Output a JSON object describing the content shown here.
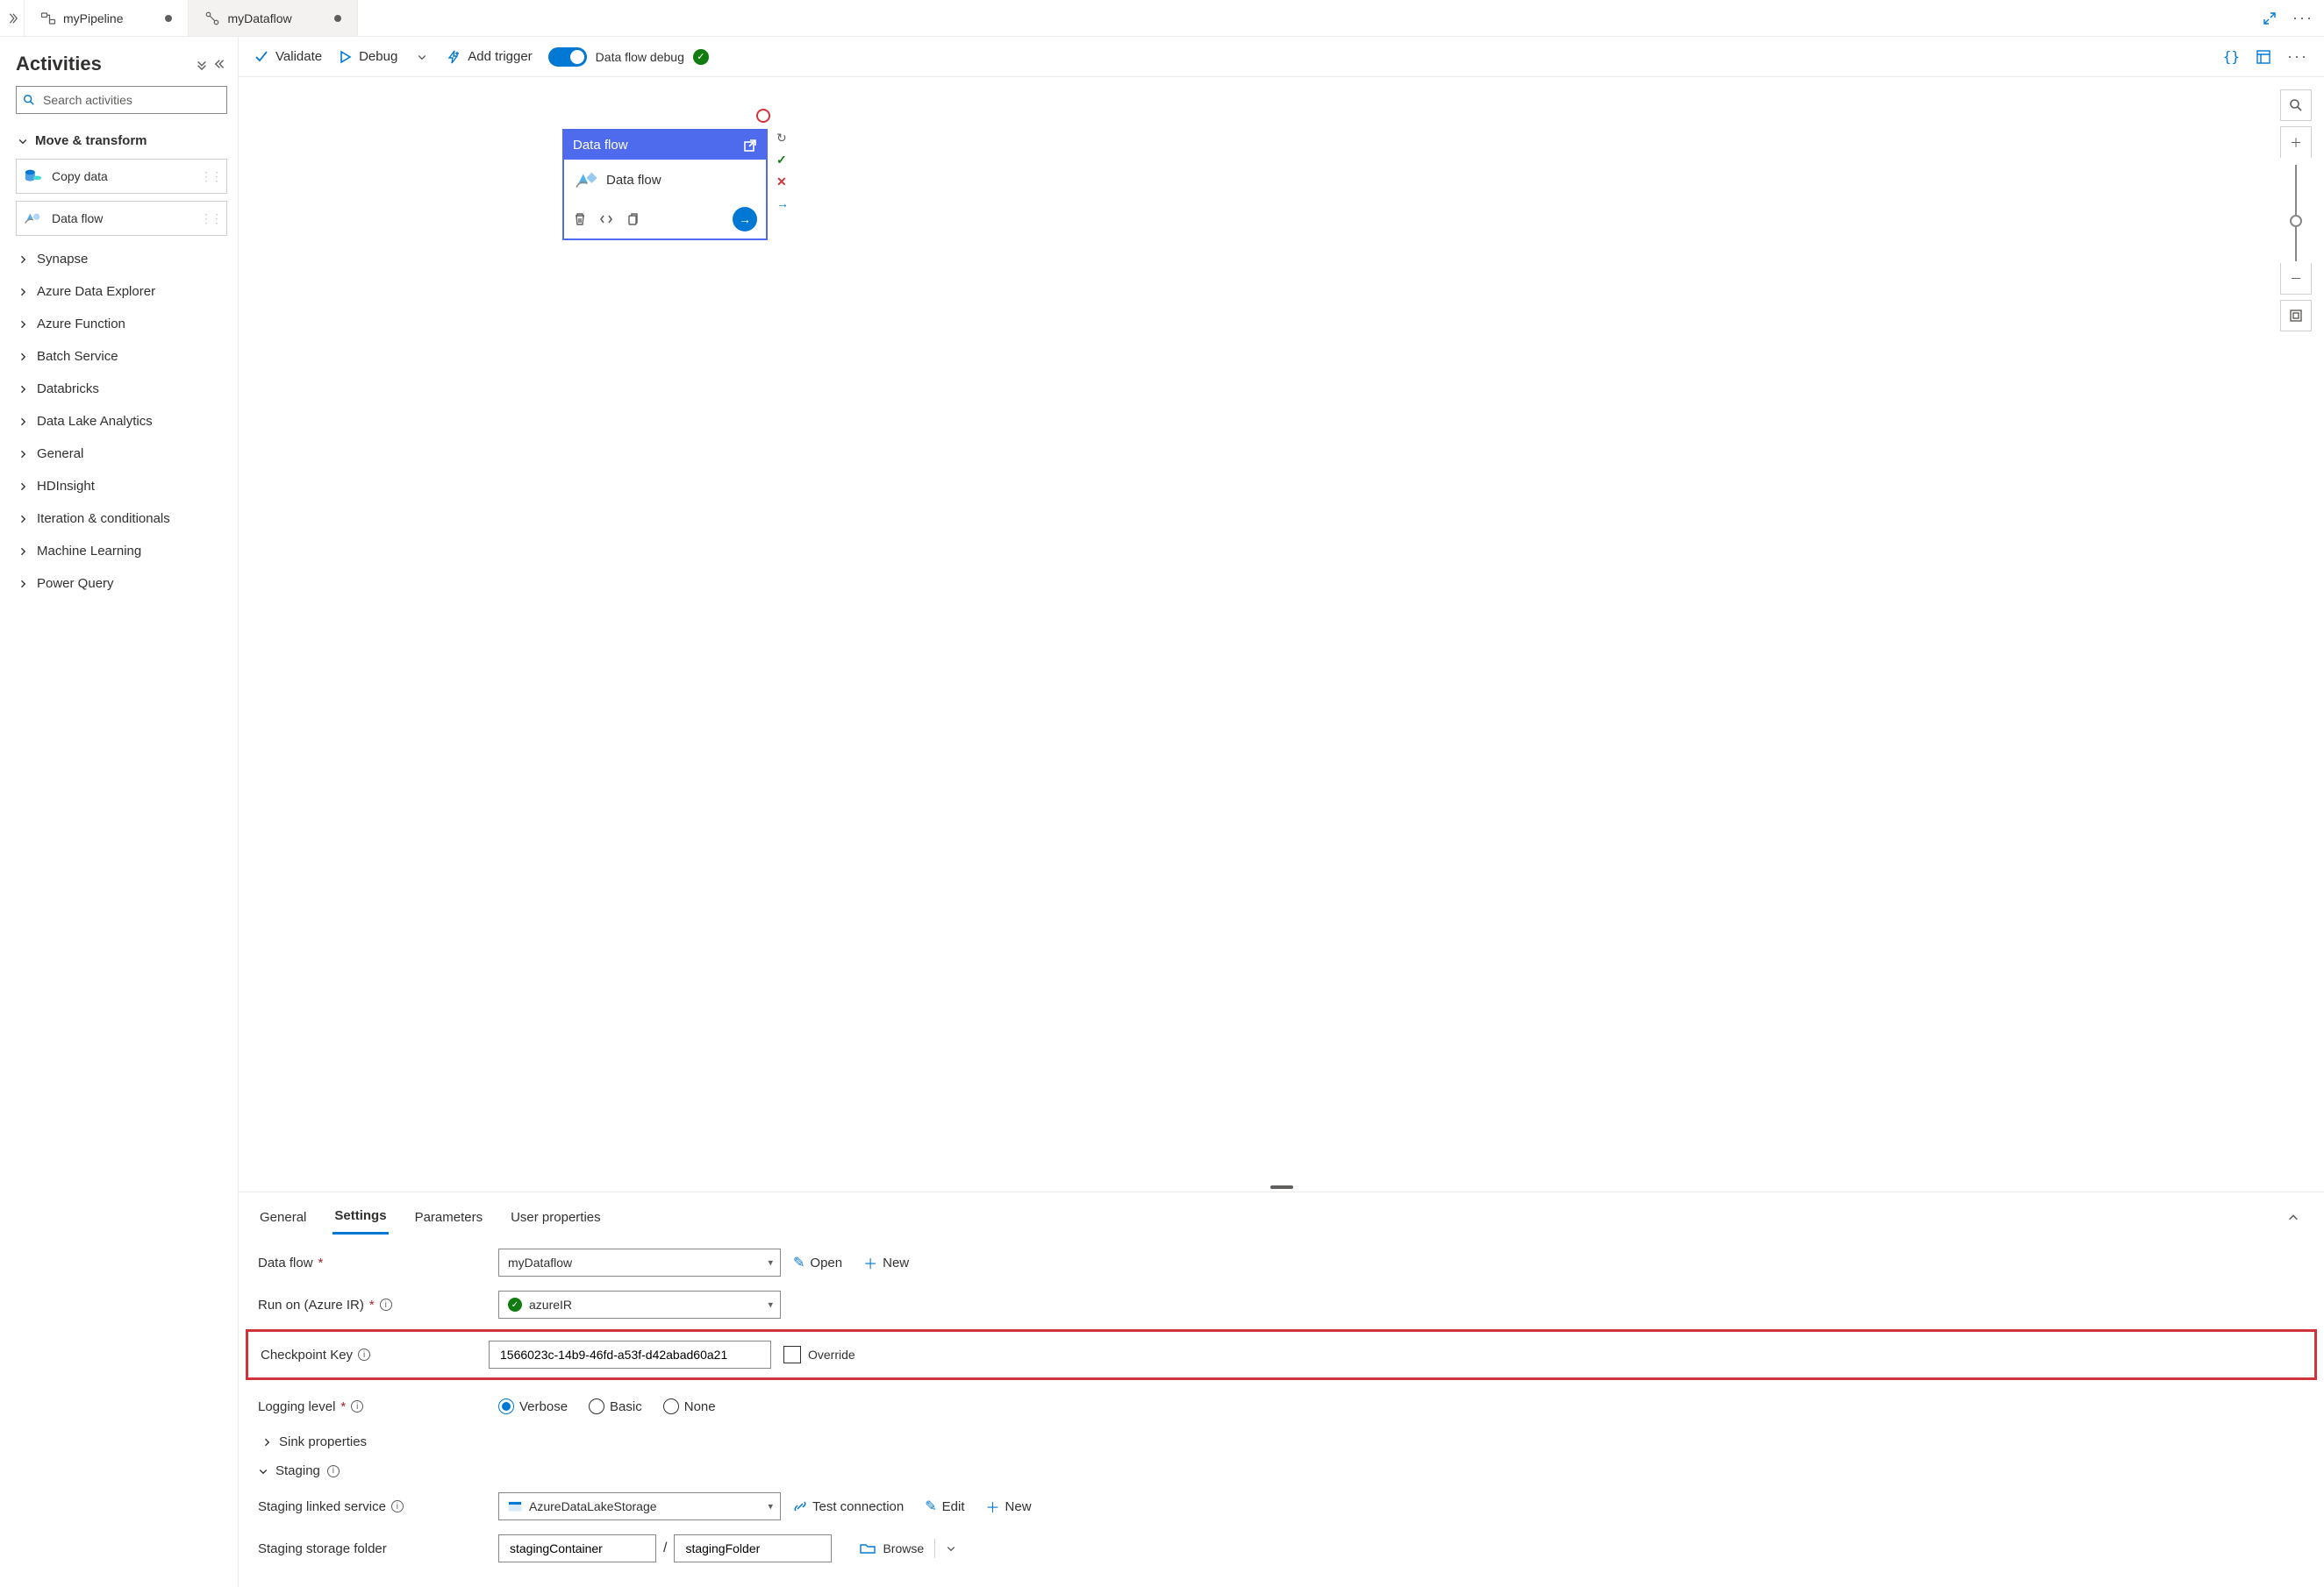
{
  "tabs": [
    {
      "label": "myPipeline",
      "active": true,
      "dirty": true
    },
    {
      "label": "myDataflow",
      "active": false,
      "dirty": true
    }
  ],
  "sidebar": {
    "title": "Activities",
    "search_placeholder": "Search activities",
    "expanded_group": "Move & transform",
    "activities": [
      {
        "label": "Copy data"
      },
      {
        "label": "Data flow"
      }
    ],
    "collapsed_groups": [
      "Synapse",
      "Azure Data Explorer",
      "Azure Function",
      "Batch Service",
      "Databricks",
      "Data Lake Analytics",
      "General",
      "HDInsight",
      "Iteration & conditionals",
      "Machine Learning",
      "Power Query"
    ]
  },
  "toolbar": {
    "validate": "Validate",
    "debug": "Debug",
    "add_trigger": "Add trigger",
    "dataflow_debug": "Data flow debug"
  },
  "canvas_node": {
    "title": "Data flow",
    "name": "Data flow"
  },
  "props": {
    "tabs": [
      "General",
      "Settings",
      "Parameters",
      "User properties"
    ],
    "active_tab": "Settings",
    "labels": {
      "data_flow": "Data flow",
      "run_on": "Run on (Azure IR)",
      "checkpoint": "Checkpoint Key",
      "override": "Override",
      "logging": "Logging level",
      "sink": "Sink properties",
      "staging": "Staging",
      "staging_linked": "Staging linked service",
      "staging_folder": "Staging storage folder",
      "open": "Open",
      "new": "New",
      "test": "Test connection",
      "edit": "Edit",
      "browse": "Browse"
    },
    "values": {
      "data_flow": "myDataflow",
      "run_on": "azureIR",
      "checkpoint": "1566023c-14b9-46fd-a53f-d42abad60a21",
      "staging_linked": "AzureDataLakeStorage",
      "staging_container": "stagingContainer",
      "staging_folder": "stagingFolder"
    },
    "logging_options": [
      "Verbose",
      "Basic",
      "None"
    ],
    "logging_selected": "Verbose"
  }
}
